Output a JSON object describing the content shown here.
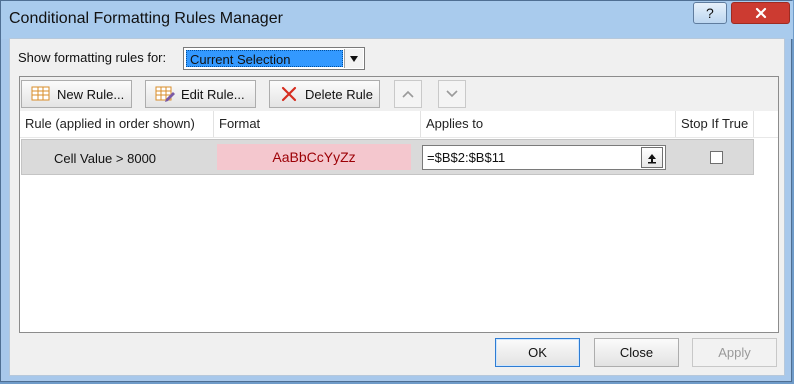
{
  "window": {
    "title": "Conditional Formatting Rules Manager"
  },
  "show_rules": {
    "label": "Show formatting rules for:",
    "selected": "Current Selection"
  },
  "toolbar": {
    "new_rule": "New Rule...",
    "edit_rule": "Edit Rule...",
    "delete_rule": "Delete Rule"
  },
  "table": {
    "columns": [
      "Rule (applied in order shown)",
      "Format",
      "Applies to",
      "Stop If True"
    ],
    "rows": [
      {
        "rule": "Cell Value > 8000",
        "format_preview": "AaBbCcYyZz",
        "applies_to": "=$B$2:$B$11",
        "stop_if_true": false
      }
    ]
  },
  "footer": {
    "ok": "OK",
    "close": "Close",
    "apply": "Apply"
  },
  "colors": {
    "format_fill": "#f4c7ce",
    "format_text": "#9c0006",
    "selected_highlight": "#3399ff",
    "close_button": "#cc3b31"
  },
  "icons": {
    "help": "help-icon",
    "close": "close-icon",
    "new_rule": "new-rule-icon",
    "edit_rule": "edit-rule-icon",
    "delete_rule": "delete-icon",
    "move_up": "chevron-up-icon",
    "move_down": "chevron-down-icon",
    "collapse_dialog": "collapse-dialog-icon",
    "dropdown": "dropdown-arrow-icon"
  }
}
